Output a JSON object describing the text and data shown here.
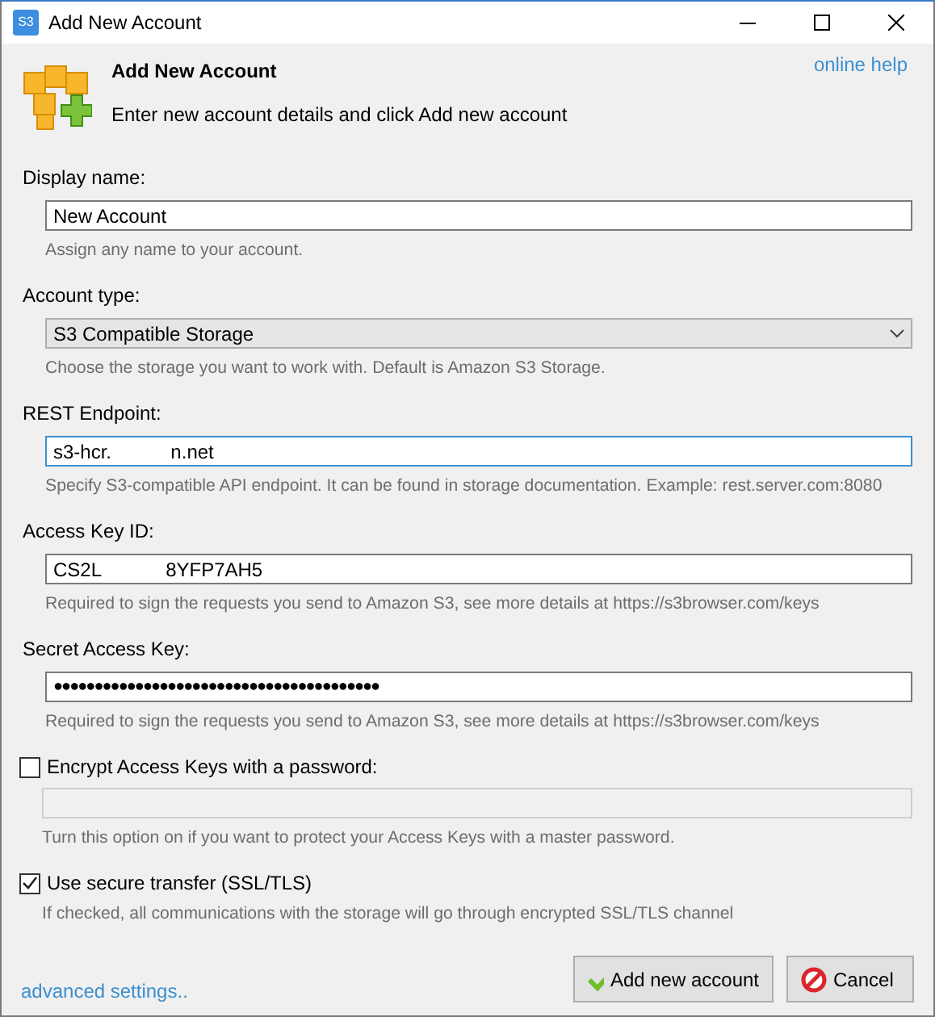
{
  "window": {
    "title": "Add New Account",
    "icon_label": "S3"
  },
  "header": {
    "title": "Add New Account",
    "subtitle": "Enter new account details and click Add new account",
    "help_link": "online help"
  },
  "fields": [
    {
      "kind": "text",
      "label": "Display name:",
      "value": "New Account",
      "hint": "Assign any name to your account.",
      "focused": false
    },
    {
      "kind": "select",
      "label": "Account type:",
      "value": "S3 Compatible Storage",
      "hint": "Choose the storage you want to work with. Default is Amazon S3 Storage."
    },
    {
      "kind": "text",
      "label": "REST Endpoint:",
      "value": "s3-hcr.           n.net",
      "hint": "Specify S3-compatible API endpoint. It can be found in storage documentation. Example: rest.server.com:8080",
      "focused": true
    },
    {
      "kind": "text",
      "label": "Access Key ID:",
      "value": "CS2L            8YFP7AH5",
      "hint": "Required to sign the requests you send to Amazon S3, see more details at https://s3browser.com/keys",
      "focused": false
    },
    {
      "kind": "password",
      "label": "Secret Access Key:",
      "value": "●●●●●●●●●●●●●●●●●●●●●●●●●●●●●●●●●●●●●●●●",
      "hint": "Required to sign the requests you send to Amazon S3, see more details at https://s3browser.com/keys"
    },
    {
      "kind": "checkbox",
      "label": "Encrypt Access Keys with a password:",
      "checked": false,
      "field": {
        "disabled": true
      },
      "hint": "Turn this option on if you want to protect your Access Keys with a master password."
    },
    {
      "kind": "checkbox",
      "label": "Use secure transfer (SSL/TLS)",
      "checked": true,
      "hint": "If checked, all communications with the storage will go through encrypted SSL/TLS channel"
    }
  ],
  "footer": {
    "link": "advanced settings..",
    "buttons": [
      {
        "kind": "ok",
        "label": "Add new account"
      },
      {
        "kind": "cancel",
        "label": "Cancel"
      }
    ]
  }
}
